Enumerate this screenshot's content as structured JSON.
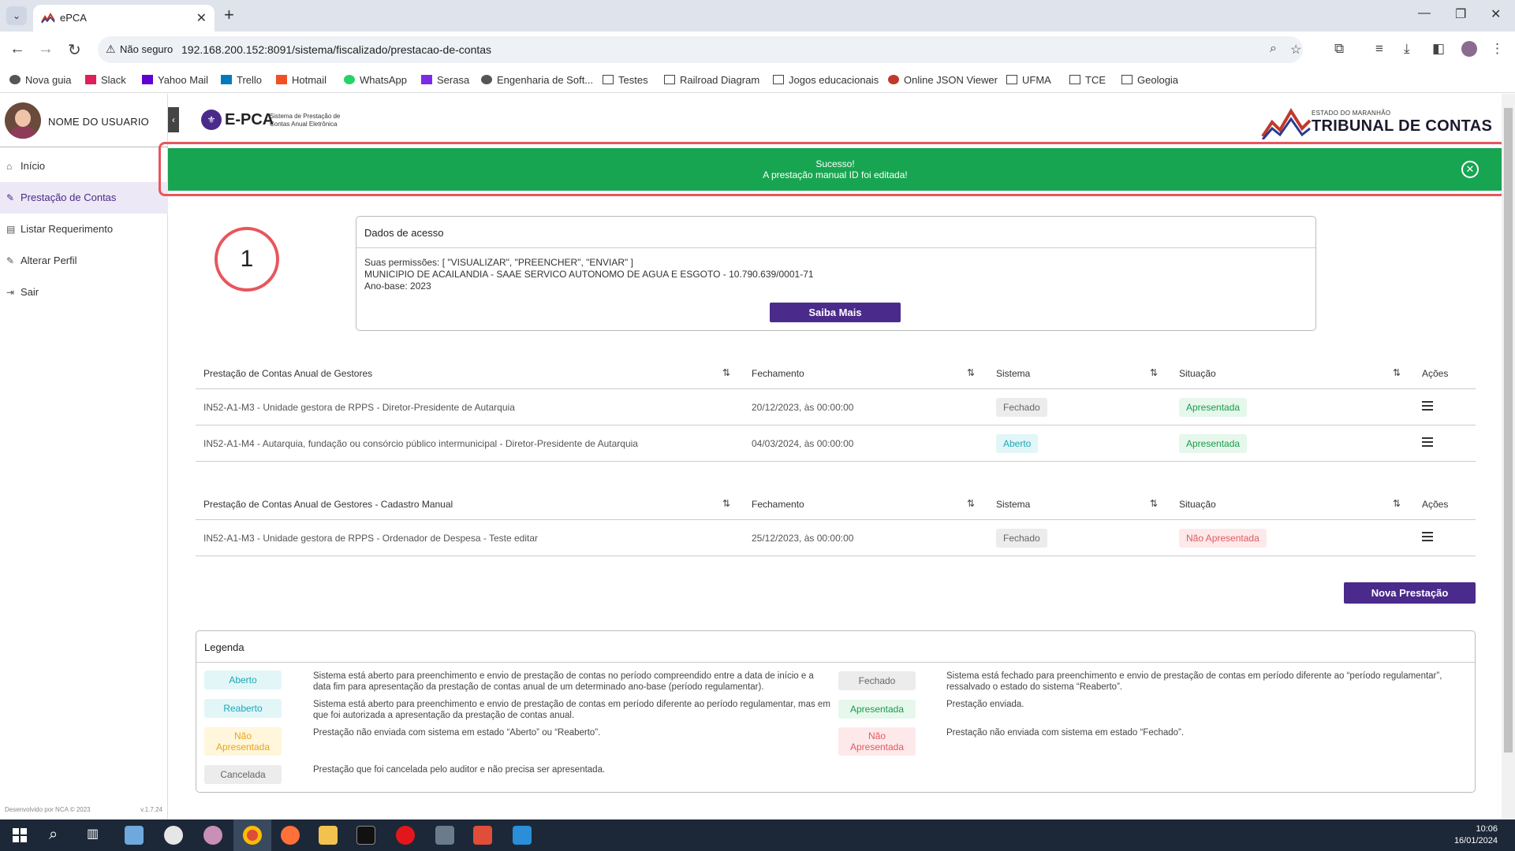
{
  "browser": {
    "tab_title": "ePCA",
    "security_label": "Não seguro",
    "url": "192.168.200.152:8091/sistema/fiscalizado/prestacao-de-contas",
    "bookmarks": [
      "Nova guia",
      "Slack",
      "Yahoo Mail",
      "Trello",
      "Hotmail",
      "WhatsApp",
      "Serasa",
      "Engenharia de Soft...",
      "Testes",
      "Railroad Diagram",
      "Jogos educacionais",
      "Online JSON Viewer",
      "UFMA",
      "TCE",
      "Geologia"
    ]
  },
  "sidebar": {
    "user_name": "NOME DO USUARIO",
    "items": [
      {
        "label": "Início",
        "icon": "home-icon"
      },
      {
        "label": "Prestação de Contas",
        "icon": "user-edit-icon"
      },
      {
        "label": "Listar Requerimento",
        "icon": "document-icon"
      },
      {
        "label": "Alterar Perfil",
        "icon": "user-edit-icon"
      },
      {
        "label": "Sair",
        "icon": "logout-icon"
      }
    ],
    "developer": "Desenvolvido por NCA © 2023",
    "version": "v.1.7.24"
  },
  "header": {
    "brand": "E-PCA",
    "brand_sub": "Sistema de Prestação de Contas Anual Eletrônica",
    "tce_small": "ESTADO DO MARANHÃO",
    "tce_big": "TRIBUNAL DE CONTAS"
  },
  "alert": {
    "title": "Sucesso!",
    "message": "A prestação manual ID foi editada!"
  },
  "annotation": {
    "step": "1"
  },
  "access": {
    "title": "Dados de acesso",
    "permissions": "Suas permissões: [ \"VISUALIZAR\", \"PREENCHER\", \"ENVIAR\" ]",
    "entity": "MUNICIPIO DE ACAILANDIA - SAAE SERVICO AUTONOMO DE AGUA E ESGOTO - 10.790.639/0001-71",
    "year": "Ano-base: 2023",
    "button": "Saiba Mais"
  },
  "table1": {
    "headers": [
      "Prestação de Contas Anual de Gestores",
      "Fechamento",
      "Sistema",
      "Situação",
      "Ações"
    ],
    "rows": [
      {
        "name": "IN52-A1-M3 - Unidade gestora de RPPS - Diretor-Presidente de Autarquia",
        "closing": "20/12/2023, às 00:00:00",
        "system": "Fechado",
        "status": "Apresentada"
      },
      {
        "name": "IN52-A1-M4 - Autarquia, fundação ou consórcio público intermunicipal - Diretor-Presidente de Autarquia",
        "closing": "04/03/2024, às 00:00:00",
        "system": "Aberto",
        "status": "Apresentada"
      }
    ]
  },
  "table2": {
    "headers": [
      "Prestação de Contas Anual de Gestores - Cadastro Manual",
      "Fechamento",
      "Sistema",
      "Situação",
      "Ações"
    ],
    "rows": [
      {
        "name": "IN52-A1-M3 - Unidade gestora de RPPS - Ordenador de Despesa - Teste editar",
        "closing": "25/12/2023, às 00:00:00",
        "system": "Fechado",
        "status": "Não Apresentada"
      }
    ]
  },
  "new_button": "Nova Prestação",
  "legend": {
    "title": "Legenda",
    "left": [
      {
        "badge": "Aberto",
        "text": "Sistema está aberto para preenchimento e envio de prestação de contas no período compreendido entre a data de início e a data fim para apresentação da prestação de contas anual de um determinado ano-base (período regulamentar)."
      },
      {
        "badge": "Reaberto",
        "text": "Sistema está aberto para preenchimento e envio de prestação de contas em período diferente ao período regulamentar, mas em que foi autorizada a apresentação da prestação de contas anual."
      },
      {
        "badge": "Não Apresentada",
        "text": "Prestação não enviada com sistema em estado “Aberto” ou “Reaberto”."
      },
      {
        "badge": "Cancelada",
        "text": "Prestação que foi cancelada pelo auditor e não precisa ser apresentada."
      }
    ],
    "right": [
      {
        "badge": "Fechado",
        "text": "Sistema está fechado para preenchimento e envio de prestação de contas em período diferente ao “período regulamentar”, ressalvado o estado do sistema “Reaberto”."
      },
      {
        "badge": "Apresentada",
        "text": "Prestação enviada."
      },
      {
        "badge": "Não Apresentada",
        "text": "Prestação não enviada com sistema em estado “Fechado”."
      }
    ]
  },
  "taskbar": {
    "time": "10:06",
    "date": "16/01/2024"
  },
  "colors": {
    "accent": "#4a2a8a",
    "success": "#18a551",
    "annotation": "#e8565c"
  }
}
